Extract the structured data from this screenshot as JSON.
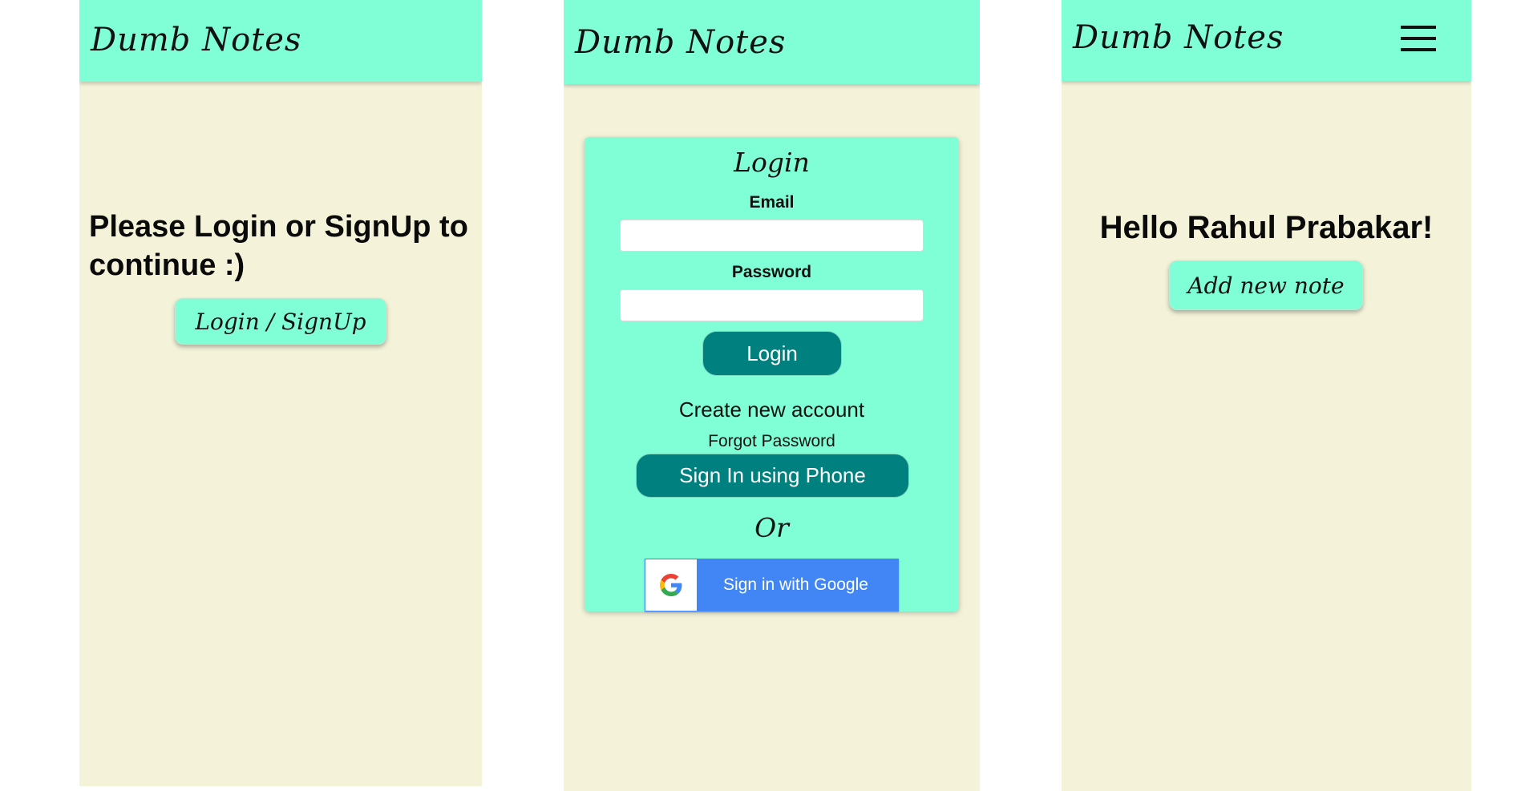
{
  "app": {
    "brand": "Dumb Notes"
  },
  "screen_logged_out": {
    "message": "Please Login or SignUp to continue :)",
    "login_signup_button": "Login / SignUp"
  },
  "screen_login": {
    "card_title": "Login",
    "email_label": "Email",
    "email_value": "",
    "password_label": "Password",
    "password_value": "",
    "login_button": "Login",
    "create_account_link": "Create new account",
    "forgot_password_link": "Forgot Password",
    "phone_signin_button": "Sign In using Phone",
    "or_text": "Or",
    "google_button": "Sign in with Google",
    "google_icon": "google-g-logo"
  },
  "screen_home": {
    "greeting": "Hello Rahul Prabakar!",
    "add_note_button": "Add new note",
    "menu_icon": "hamburger-menu"
  },
  "colors": {
    "header": "#80ffd6",
    "background": "#f4f3da",
    "teal_button": "#00807f",
    "google_blue": "#4285f4"
  }
}
